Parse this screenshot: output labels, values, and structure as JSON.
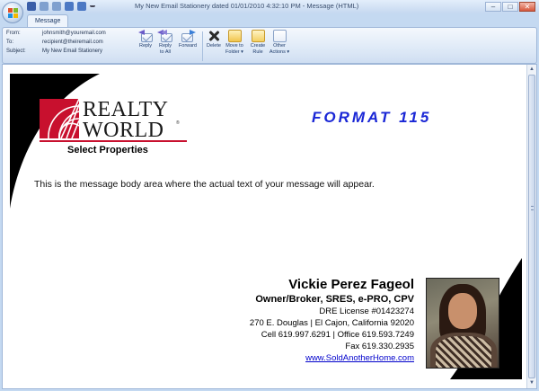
{
  "window": {
    "title": "My New Email Stationery  dated 01/01/2010  4:32:10 PM  -  Message (HTML)",
    "controls": {
      "minimize": "–",
      "maximize": "□",
      "close": "✕"
    }
  },
  "ribbon": {
    "tab": "Message",
    "header": {
      "from_label": "From:",
      "from_value": "johnsmith@youremail.com",
      "to_label": "To:",
      "to_value": "recipient@theiremail.com",
      "subject_label": "Subject:",
      "subject_value": "My New Email Stationery"
    },
    "buttons": {
      "reply": "Reply",
      "reply_all_1": "Reply",
      "reply_all_2": "to All",
      "forward": "Forward",
      "delete": "Delete",
      "move_1": "Move to",
      "move_2": "Folder ▾",
      "rule_1": "Create",
      "rule_2": "Rule",
      "other_1": "Other",
      "other_2": "Actions ▾"
    }
  },
  "stationery": {
    "logo_line1": "REALTY",
    "logo_line2": "WORLD",
    "logo_tm": "®",
    "subtitle": "Select Properties",
    "format_title": "FORMAT 115",
    "body_text": "This is the message body area where the actual text of your message will appear.",
    "signature": {
      "name": "Vickie Perez Fageol",
      "role": "Owner/Broker, SRES, e-PRO, CPV",
      "license": "DRE License #01423274",
      "address": "270 E. Douglas | El Cajon, California 92020",
      "phones": "Cell 619.997.6291 | Office 619.593.7249",
      "fax": "Fax 619.330.2935",
      "website": "www.SoldAnotherHome.com"
    }
  },
  "colors": {
    "brand_red": "#c8102e",
    "format_blue": "#1a27d6",
    "link_blue": "#0000cc"
  }
}
